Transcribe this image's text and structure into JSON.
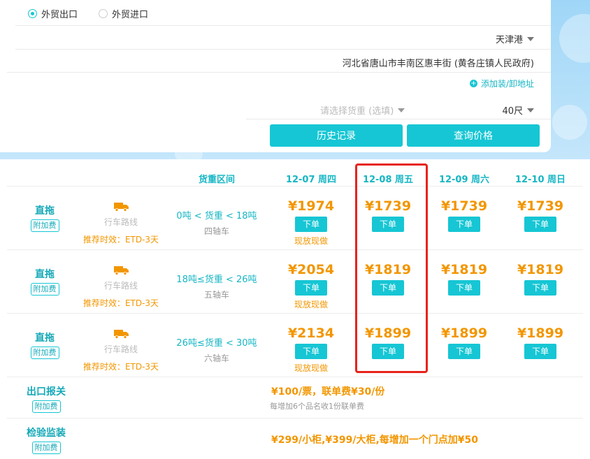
{
  "form": {
    "radio_export": "外贸出口",
    "radio_import": "外贸进口",
    "port": "天津港",
    "address": "河北省唐山市丰南区惠丰街 (黄各庄镇人民政府)",
    "add_link": "添加装/卸地址",
    "cargo_weight_placeholder": "请选择货重 (选填)",
    "container_size": "40尺",
    "history_button": "历史记录",
    "query_button": "查询价格"
  },
  "table": {
    "headers": {
      "weight_range": "货重区间",
      "dates": [
        "12-07 周四",
        "12-08 周五",
        "12-09 周六",
        "12-10 周日"
      ]
    },
    "rows": [
      {
        "type": "直拖",
        "tag": "附加费",
        "route": "行车路线",
        "etd": "推荐时效：ETD-3天",
        "range": "0吨 < 货重 < 18吨",
        "axle": "四轴车",
        "prices": [
          "¥1974",
          "¥1739",
          "¥1739",
          "¥1739"
        ],
        "order_label": "下单",
        "note": "现放现做"
      },
      {
        "type": "直拖",
        "tag": "附加费",
        "route": "行车路线",
        "etd": "推荐时效：ETD-3天",
        "range": "18吨≤货重 < 26吨",
        "axle": "五轴车",
        "prices": [
          "¥2054",
          "¥1819",
          "¥1819",
          "¥1819"
        ],
        "order_label": "下单",
        "note": "现放现做"
      },
      {
        "type": "直拖",
        "tag": "附加费",
        "route": "行车路线",
        "etd": "推荐时效：ETD-3天",
        "range": "26吨≤货重 < 30吨",
        "axle": "六轴车",
        "prices": [
          "¥2134",
          "¥1899",
          "¥1899",
          "¥1899"
        ],
        "order_label": "下单",
        "note": "现放现做"
      }
    ],
    "extras": [
      {
        "name": "出口报关",
        "tag": "附加费",
        "price": "¥100/票，联单费¥30/份",
        "sub": "每增加6个品名收1份联单费"
      },
      {
        "name": "检验监装",
        "tag": "附加费",
        "price": "¥299/小柜,¥399/大柜,每增加一个门点加¥50",
        "sub": ""
      }
    ]
  },
  "colors": {
    "accent": "#16c6d4",
    "price": "#f29600",
    "highlight": "#e8231c"
  }
}
